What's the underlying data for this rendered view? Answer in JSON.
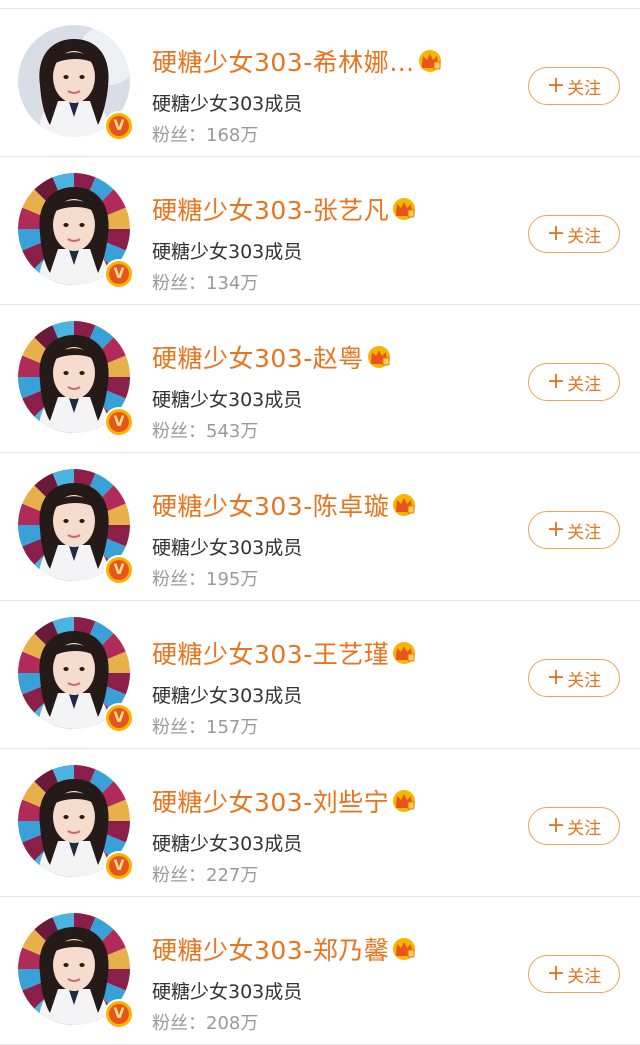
{
  "colors": {
    "accent": "#e8741e",
    "badge_gold": "#f7b500",
    "badge_red": "#e8541d",
    "divider": "#e6e6e6",
    "fans_gray": "#9a9a9a"
  },
  "follow_plus": "+",
  "users": [
    {
      "name": "硬糖少女303-希林娜…",
      "desc": "硬糖少女303成员",
      "fans_label": "粉丝：",
      "fans_value": "168万",
      "follow_label": "关注",
      "verified_badge": "V",
      "crown_icon": "vip-crown-icon",
      "avatar_bg": "photo"
    },
    {
      "name": "硬糖少女303-张艺凡",
      "desc": "硬糖少女303成员",
      "fans_label": "粉丝：",
      "fans_value": "134万",
      "follow_label": "关注",
      "verified_badge": "V",
      "crown_icon": "vip-crown-icon",
      "avatar_bg": "pinwheel"
    },
    {
      "name": "硬糖少女303-赵粤",
      "desc": "硬糖少女303成员",
      "fans_label": "粉丝：",
      "fans_value": "543万",
      "follow_label": "关注",
      "verified_badge": "V",
      "crown_icon": "vip-crown-icon",
      "avatar_bg": "pinwheel"
    },
    {
      "name": "硬糖少女303-陈卓璇",
      "desc": "硬糖少女303成员",
      "fans_label": "粉丝：",
      "fans_value": "195万",
      "follow_label": "关注",
      "verified_badge": "V",
      "crown_icon": "vip-crown-icon",
      "avatar_bg": "pinwheel"
    },
    {
      "name": "硬糖少女303-王艺瑾",
      "desc": "硬糖少女303成员",
      "fans_label": "粉丝：",
      "fans_value": "157万",
      "follow_label": "关注",
      "verified_badge": "V",
      "crown_icon": "vip-crown-icon",
      "avatar_bg": "pinwheel"
    },
    {
      "name": "硬糖少女303-刘些宁",
      "desc": "硬糖少女303成员",
      "fans_label": "粉丝：",
      "fans_value": "227万",
      "follow_label": "关注",
      "verified_badge": "V",
      "crown_icon": "vip-crown-icon",
      "avatar_bg": "pinwheel"
    },
    {
      "name": "硬糖少女303-郑乃馨",
      "desc": "硬糖少女303成员",
      "fans_label": "粉丝：",
      "fans_value": "208万",
      "follow_label": "关注",
      "verified_badge": "V",
      "crown_icon": "vip-crown-icon",
      "avatar_bg": "pinwheel"
    }
  ]
}
